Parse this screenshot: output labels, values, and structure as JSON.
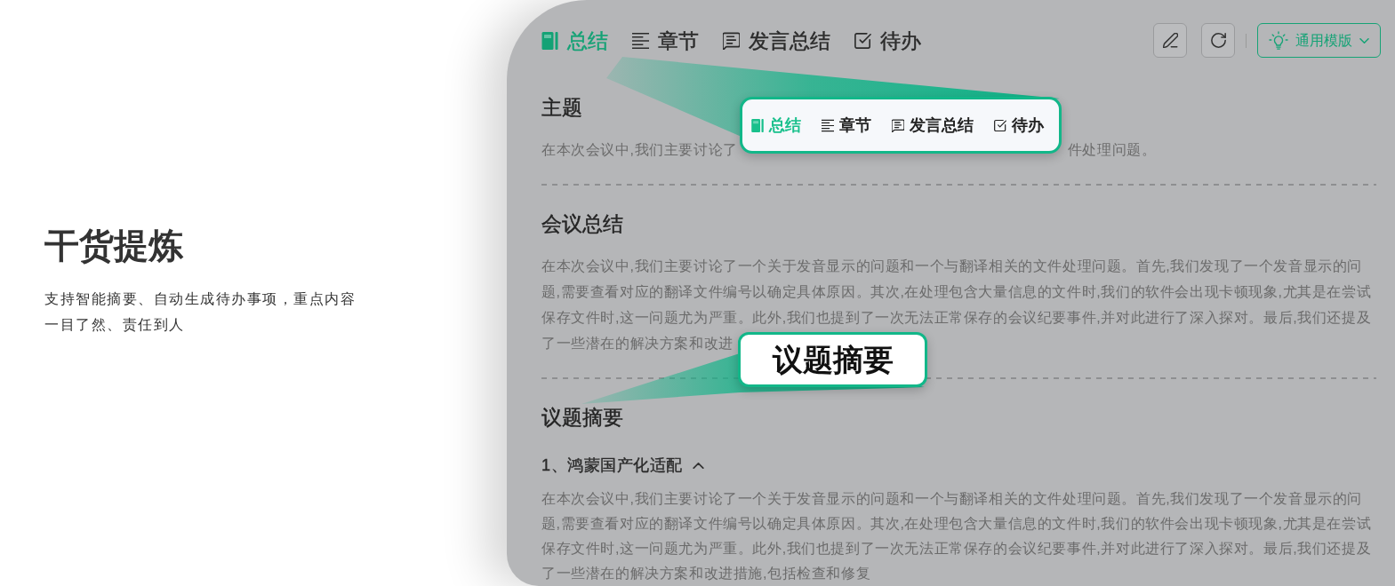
{
  "intro": {
    "title": "干货提炼",
    "description": "支持智能摘要、自动生成待办事项，重点内容一目了然、责任到人"
  },
  "toolbar": {
    "tabs": [
      {
        "label": "总结",
        "selected": true
      },
      {
        "label": "章节",
        "selected": false
      },
      {
        "label": "发言总结",
        "selected": false
      },
      {
        "label": "待办",
        "selected": false
      }
    ],
    "template_button": "通用模版"
  },
  "sections": [
    {
      "heading": "主题",
      "text_fragments": [
        "在本次会议中,我们主要讨论了",
        "件处理问题。"
      ]
    },
    {
      "heading": "会议总结",
      "text": "在本次会议中,我们主要讨论了一个关于发音显示的问题和一个与翻译相关的文件处理问题。首先,我们发现了一个发音显示的问题,需要查看对应的翻译文件编号以确定具体原因。其次,在处理包含大量信息的文件时,我们的软件会出现卡顿现象,尤其是在尝试保存文件时,这一问题尤为严重。此外,我们也提到了一次无法正常保存的会议纪要事件,并对此进行了深入探对。最后,我们还提及了一些潜在的解决方案和改进"
    },
    {
      "heading": "议题摘要",
      "topics": [
        {
          "title": "1、鸿蒙国产化适配",
          "expanded": true,
          "text": "在本次会议中,我们主要讨论了一个关于发音显示的问题和一个与翻译相关的文件处理问题。首先,我们发现了一个发音显示的问题,需要查看对应的翻译文件编号以确定具体原因。其次,在处理包含大量信息的文件时,我们的软件会出现卡顿现象,尤其是在尝试保存文件时,这一问题尤为严重。此外,我们也提到了一次无法正常保存的会议纪要事件,并对此进行了深入探对。最后,我们还提及了一些潜在的解决方案和改进措施,包括检查和修复"
        }
      ]
    }
  ],
  "callouts": {
    "tabs": [
      {
        "label": "总结",
        "selected": true
      },
      {
        "label": "章节",
        "selected": false
      },
      {
        "label": "发言总结",
        "selected": false
      },
      {
        "label": "待办",
        "selected": false
      }
    ],
    "label": "议题摘要"
  }
}
